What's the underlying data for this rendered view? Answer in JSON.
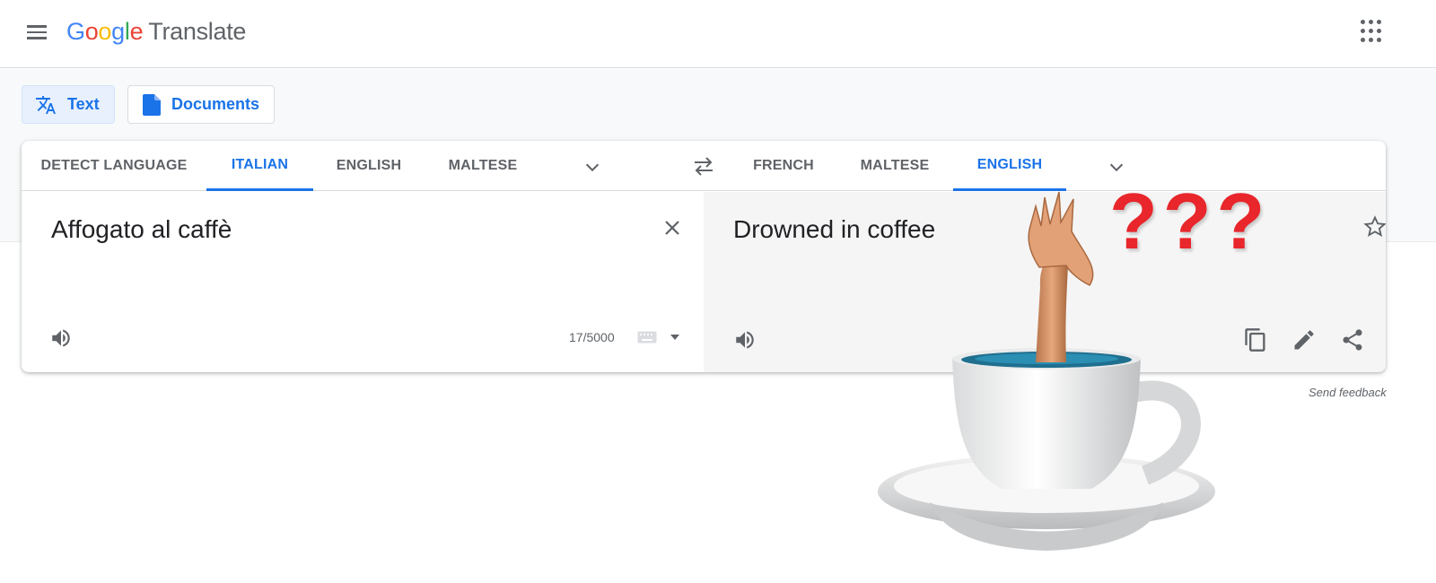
{
  "header": {
    "logo_letters": [
      "G",
      "o",
      "o",
      "g",
      "l",
      "e"
    ],
    "product_name": "Translate",
    "menu_icon": "hamburger-menu-icon",
    "apps_icon": "apps-grid-icon"
  },
  "modes": {
    "text_label": "Text",
    "documents_label": "Documents",
    "text_icon": "translate-icon",
    "documents_icon": "document-icon",
    "active": "Text"
  },
  "source_languages": {
    "tabs": [
      "DETECT LANGUAGE",
      "ITALIAN",
      "ENGLISH",
      "MALTESE"
    ],
    "active": "ITALIAN"
  },
  "target_languages": {
    "tabs": [
      "FRENCH",
      "MALTESE",
      "ENGLISH"
    ],
    "active": "ENGLISH"
  },
  "source": {
    "text": "Affogato al caffè",
    "char_count": "17/5000"
  },
  "target": {
    "text": "Drowned in coffee"
  },
  "overlay": {
    "question_marks": "???"
  },
  "footer": {
    "feedback": "Send feedback"
  },
  "colors": {
    "accent": "#1a73e8",
    "active_tab_bg": "#e8f0fe",
    "target_panel_bg": "#f5f5f5",
    "question_marks": "#e8262b"
  }
}
